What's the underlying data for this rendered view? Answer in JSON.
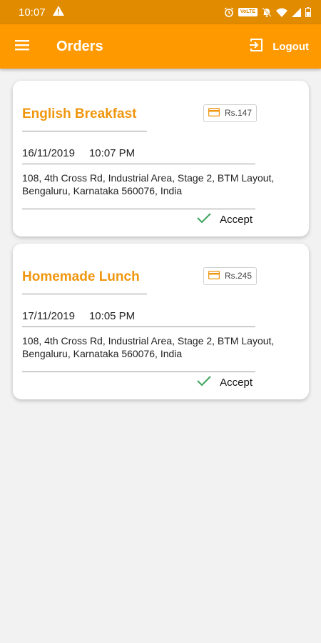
{
  "status_bar": {
    "time": "10:07",
    "icons": [
      "warning-icon",
      "alarm-icon",
      "volte-icon",
      "bell-off-icon",
      "wifi-icon",
      "signal-icon",
      "battery-icon"
    ],
    "volte_text": "VoLTE"
  },
  "app_bar": {
    "title": "Orders",
    "logout_label": "Logout",
    "color": "#ff9900"
  },
  "orders": [
    {
      "title": "English Breakfast",
      "price": "Rs.147",
      "date": "16/11/2019",
      "time": "10:07 PM",
      "address": "108, 4th Cross Rd, Industrial Area, Stage 2, BTM Layout, Bengaluru, Karnataka 560076, India",
      "accept_label": "Accept"
    },
    {
      "title": "Homemade Lunch",
      "price": "Rs.245",
      "date": "17/11/2019",
      "time": "10:05 PM",
      "address": "108, 4th Cross Rd, Industrial Area, Stage 2, BTM Layout, Bengaluru, Karnataka 560076, India",
      "accept_label": "Accept"
    }
  ],
  "colors": {
    "accent": "#f0960e",
    "accept_check": "#3aa35a"
  }
}
